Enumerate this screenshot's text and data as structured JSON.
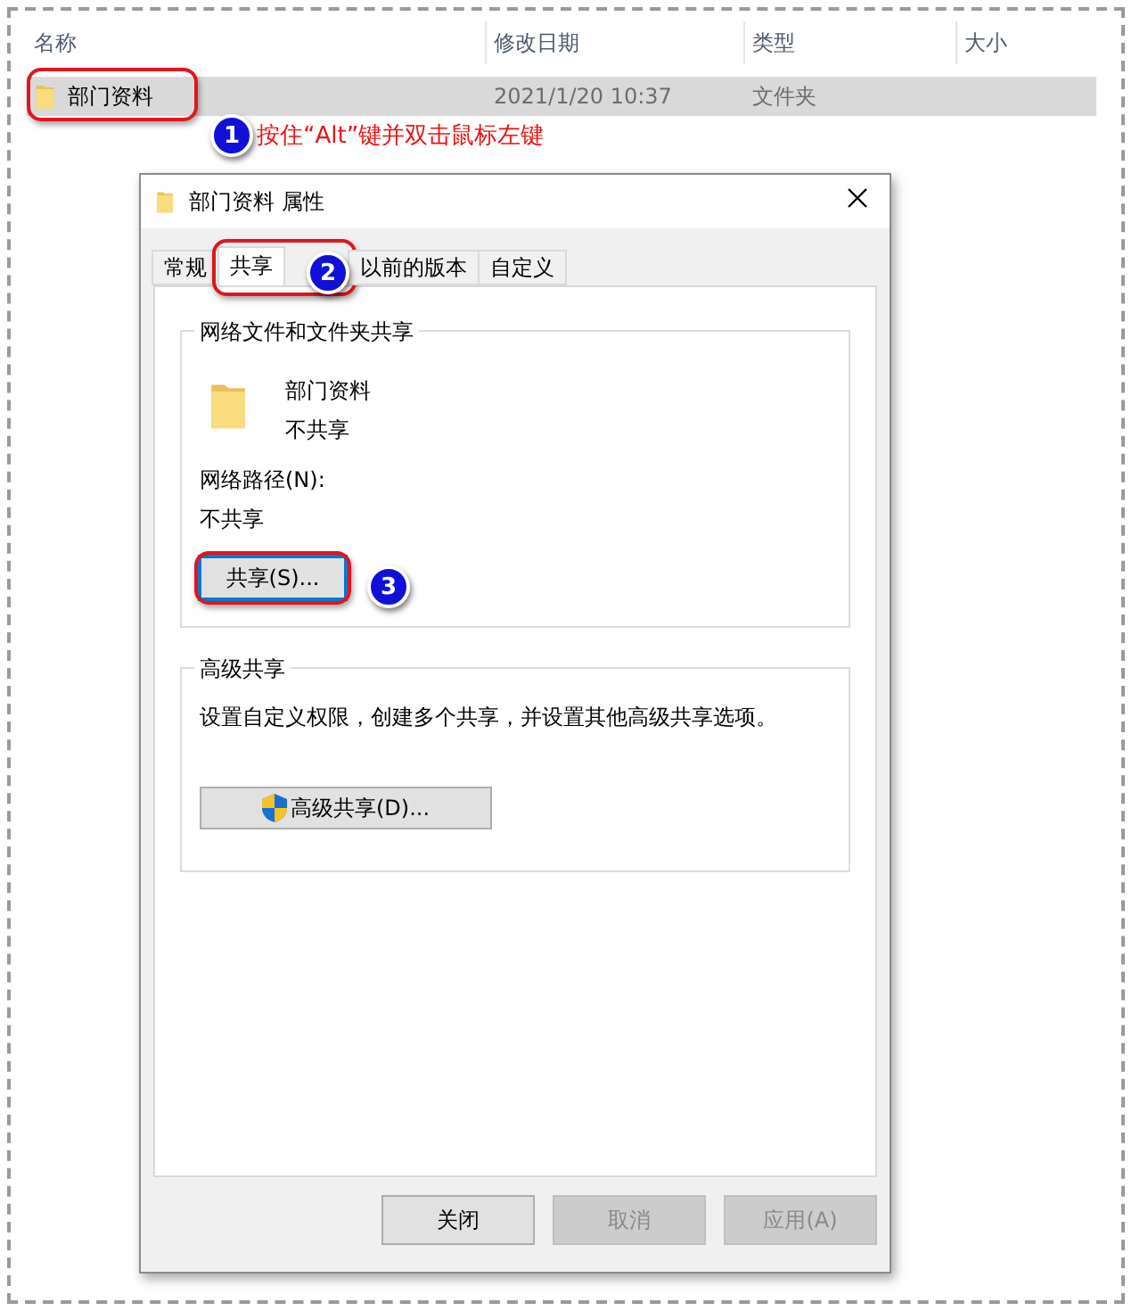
{
  "explorer": {
    "columns": [
      "名称",
      "修改日期",
      "类型",
      "大小"
    ],
    "rows": [
      {
        "name": "部门资料",
        "modified": "2021/1/20 10:37",
        "type": "文件夹",
        "selected": true
      }
    ]
  },
  "annotations": [
    {
      "number": "1",
      "text": "按住“Alt”键并双击鼠标左键"
    },
    {
      "number": "2"
    },
    {
      "number": "3"
    }
  ],
  "dialog": {
    "title": "部门资料 属性",
    "tabs": [
      {
        "label": "常规",
        "selected": false
      },
      {
        "label": "共享",
        "selected": true
      },
      {
        "label": "以前的版本",
        "selected": false
      },
      {
        "label": "自定义",
        "selected": false
      }
    ],
    "network_sharing": {
      "title": "网络文件和文件夹共享",
      "folder_name": "部门资料",
      "status": "不共享",
      "path_label": "网络路径(N):",
      "path_value": "不共享",
      "share_button": "共享(S)..."
    },
    "advanced_sharing": {
      "title": "高级共享",
      "description": "设置自定义权限，创建多个共享，并设置其他高级共享选项。",
      "button": "高级共享(D)..."
    },
    "buttons": [
      {
        "label": "关闭",
        "disabled": false
      },
      {
        "label": "取消",
        "disabled": true
      },
      {
        "label": "应用(A)",
        "disabled": true
      }
    ]
  }
}
